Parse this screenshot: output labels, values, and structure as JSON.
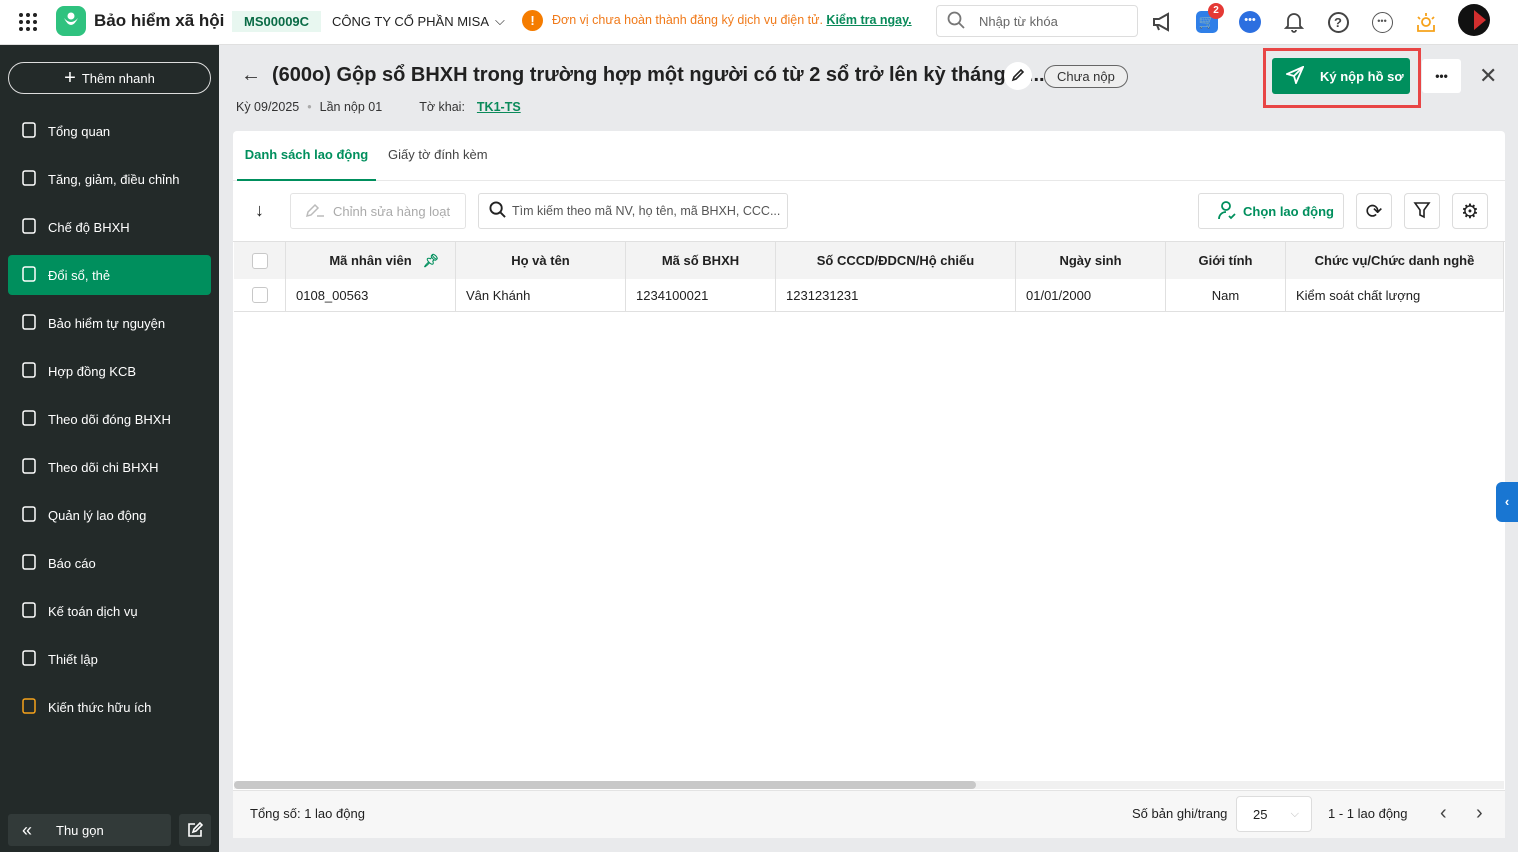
{
  "topbar": {
    "app_title": "Bảo hiểm xã hội",
    "tax_code": "MS00009C",
    "company": "CÔNG TY CỔ PHẦN MISA",
    "warning": "Đơn vị chưa hoàn thành đăng ký dịch vụ điện tử.",
    "warning_link": "Kiểm tra ngay.",
    "search_placeholder": "Nhập từ khóa",
    "cart_badge": "2"
  },
  "sidebar": {
    "quick_add": "Thêm nhanh",
    "items": [
      {
        "label": "Tổng quan"
      },
      {
        "label": "Tăng, giảm, điều chỉnh"
      },
      {
        "label": "Chế độ BHXH"
      },
      {
        "label": "Đổi sổ, thẻ"
      },
      {
        "label": "Bảo hiểm tự nguyện"
      },
      {
        "label": "Hợp đồng KCB"
      },
      {
        "label": "Theo dõi đóng BHXH"
      },
      {
        "label": "Theo dõi chi BHXH"
      },
      {
        "label": "Quản lý lao động"
      },
      {
        "label": "Báo cáo"
      },
      {
        "label": "Kế toán dịch vụ"
      },
      {
        "label": "Thiết lập"
      },
      {
        "label": "Kiến thức hữu ích"
      }
    ],
    "collapse": "Thu gọn"
  },
  "header": {
    "title": "(600o) Gộp sổ BHXH trong trường hợp một người có từ 2 sổ trở lên kỳ tháng 9/...",
    "status": "Chưa nộp",
    "period": "Kỳ 09/2025",
    "submission": "Lần nộp 01",
    "form_label": "Tờ khai:",
    "form_link": "TK1-TS",
    "submit_button": "Ký nộp hồ sơ",
    "more": "•••"
  },
  "tabs": [
    {
      "label": "Danh sách lao động"
    },
    {
      "label": "Giấy tờ đính kèm"
    }
  ],
  "toolbar": {
    "bulk_edit": "Chỉnh sửa hàng loạt",
    "search_placeholder": "Tìm kiếm theo mã NV, họ tên, mã BHXH, CCC...",
    "choose_employee": "Chọn lao động"
  },
  "table": {
    "columns": [
      "Mã nhân viên",
      "Họ và tên",
      "Mã số BHXH",
      "Số CCCD/ĐDCN/Hộ chiếu",
      "Ngày sinh",
      "Giới tính",
      "Chức vụ/Chức danh nghề"
    ],
    "rows": [
      [
        "0108_00563",
        "Vân Khánh",
        "1234100021",
        "1231231231",
        "01/01/2000",
        "Nam",
        "Kiểm soát chất lượng"
      ]
    ]
  },
  "footer": {
    "total": "Tổng số: 1 lao động",
    "per_page_label": "Số bản ghi/trang",
    "per_page": "25",
    "range": "1 - 1 lao động"
  },
  "colors": {
    "accent": "#008f5d",
    "sidebar": "#232a29",
    "warning": "#f07a1a"
  }
}
